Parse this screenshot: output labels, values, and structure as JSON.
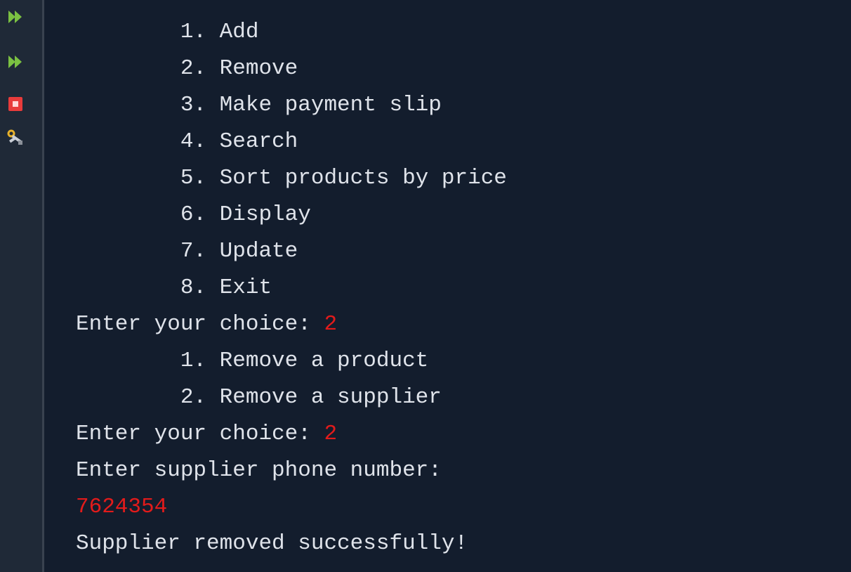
{
  "toolbar": {
    "buttons": [
      {
        "name": "rerun-icon",
        "color": "#7bc142"
      },
      {
        "name": "rerun-icon",
        "color": "#7bc142"
      },
      {
        "name": "stop-icon",
        "color": "#e83b3b"
      },
      {
        "name": "settings-tools-icon",
        "color": "#e7b12a"
      }
    ]
  },
  "console": {
    "lines": [
      {
        "text": "        1. Add",
        "input": ""
      },
      {
        "text": "        2. Remove",
        "input": ""
      },
      {
        "text": "        3. Make payment slip",
        "input": ""
      },
      {
        "text": "        4. Search",
        "input": ""
      },
      {
        "text": "        5. Sort products by price",
        "input": ""
      },
      {
        "text": "        6. Display",
        "input": ""
      },
      {
        "text": "        7. Update",
        "input": ""
      },
      {
        "text": "        8. Exit",
        "input": ""
      },
      {
        "text": "Enter your choice: ",
        "input": "2"
      },
      {
        "text": "        1. Remove a product",
        "input": ""
      },
      {
        "text": "        2. Remove a supplier",
        "input": ""
      },
      {
        "text": "Enter your choice: ",
        "input": "2"
      },
      {
        "text": "Enter supplier phone number:",
        "input": ""
      },
      {
        "text": "",
        "input": "7624354"
      },
      {
        "text": "Supplier removed successfully!",
        "input": ""
      }
    ],
    "colors": {
      "background": "#131d2d",
      "output": "#dfe3ea",
      "input": "#e21b1b"
    }
  }
}
